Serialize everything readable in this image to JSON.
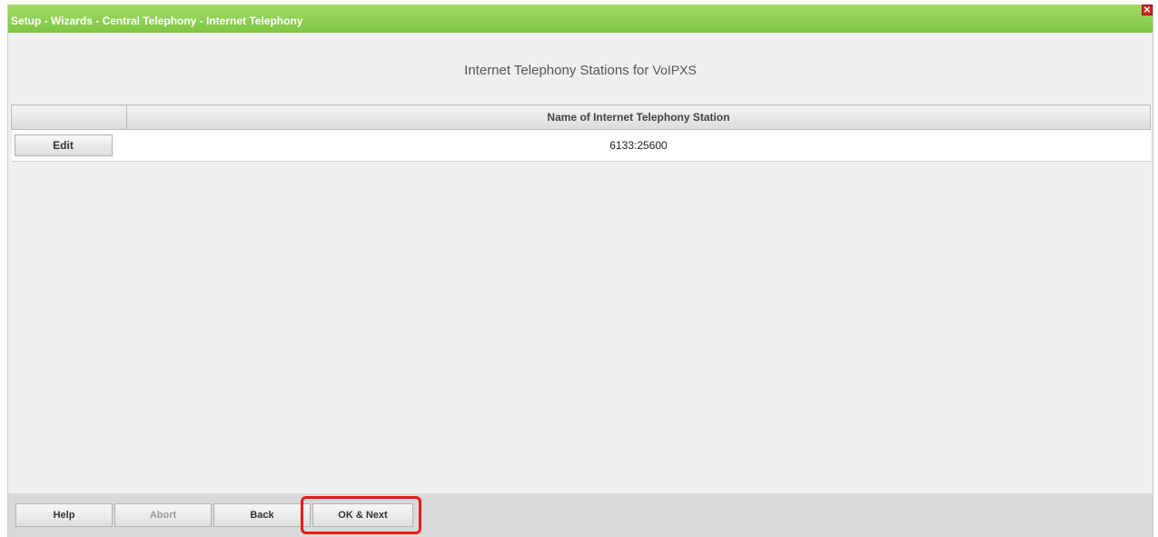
{
  "window": {
    "title": "Setup - Wizards - Central Telephony - Internet Telephony",
    "close_icon": "close-icon"
  },
  "main": {
    "heading_prefix": "Internet Telephony Stations for",
    "heading_station": "VoIPXS",
    "table": {
      "header": "Name of Internet Telephony Station",
      "rows": [
        {
          "button_label": "Edit",
          "station": "6133:25600"
        }
      ]
    }
  },
  "footer": {
    "help": "Help",
    "abort": "Abort",
    "back": "Back",
    "ok_next": "OK & Next"
  },
  "colors": {
    "titlebar": "#8fd152",
    "highlight": "#e8191a",
    "background": "#efefef"
  }
}
